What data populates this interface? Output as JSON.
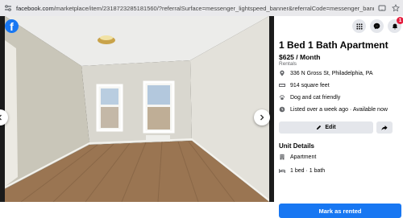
{
  "browser": {
    "url_host": "facebook.com",
    "url_path": "/marketplace/item/2318723285181560/?referralSurface=messenger_lightspeed_banner&referralCode=messenger_banner"
  },
  "listing": {
    "title": "1 Bed 1 Bath Apartment",
    "price": "$625 / Month",
    "category": "Rentals",
    "details": [
      {
        "icon": "location-pin-icon",
        "text": "336 N Gross St, Philadelphia, PA"
      },
      {
        "icon": "ruler-icon",
        "text": "914 square feet"
      },
      {
        "icon": "paw-icon",
        "text": "Dog and cat friendly"
      },
      {
        "icon": "clock-icon",
        "text": "Listed over a week ago · Available now"
      }
    ],
    "edit_label": "Edit",
    "unit_details_title": "Unit Details",
    "unit_details": [
      {
        "icon": "building-icon",
        "text": "Apartment"
      },
      {
        "icon": "bed-icon",
        "text": "1 bed · 1 bath"
      }
    ],
    "mark_rented_label": "Mark as rented"
  },
  "header": {
    "notification_count": "1"
  },
  "colors": {
    "facebook_blue": "#1877f2",
    "button_grey": "#e4e6eb",
    "badge_red": "#e41e3f"
  }
}
